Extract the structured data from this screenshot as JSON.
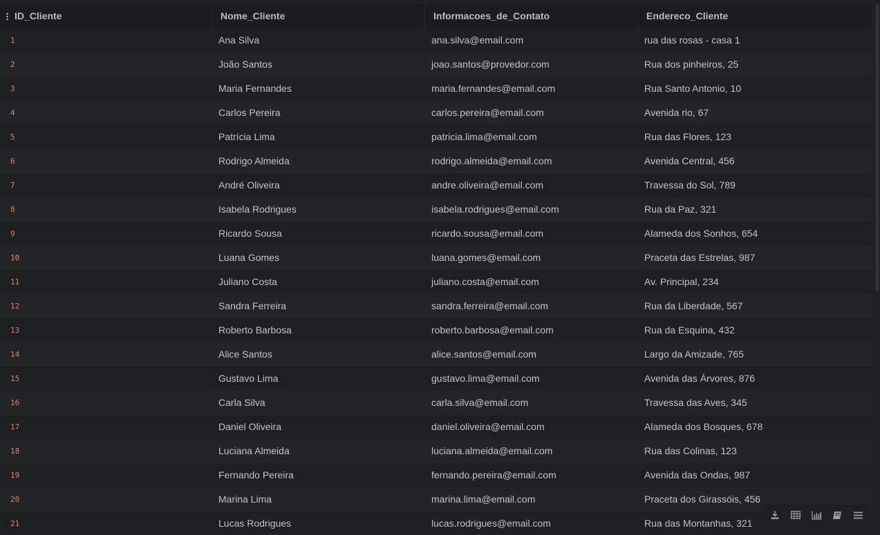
{
  "table": {
    "columns": [
      "ID_Cliente",
      "Nome_Cliente",
      "Informacoes_de_Contato",
      "Endereco_Cliente"
    ],
    "rows": [
      [
        "1",
        "Ana Silva",
        "ana.silva@email.com",
        "rua das rosas - casa 1"
      ],
      [
        "2",
        "João Santos",
        "joao.santos@provedor.com",
        "Rua dos pinheiros, 25"
      ],
      [
        "3",
        "Maria Fernandes",
        "maria.fernandes@email.com",
        "Rua Santo Antonio, 10"
      ],
      [
        "4",
        "Carlos Pereira",
        "carlos.pereira@email.com",
        "Avenida rio, 67"
      ],
      [
        "5",
        "Patrícia Lima",
        "patricia.lima@email.com",
        "Rua das Flores, 123"
      ],
      [
        "6",
        "Rodrigo Almeida",
        "rodrigo.almeida@email.com",
        "Avenida Central, 456"
      ],
      [
        "7",
        "André Oliveira",
        "andre.oliveira@email.com",
        "Travessa do Sol, 789"
      ],
      [
        "8",
        "Isabela Rodrigues",
        "isabela.rodrigues@email.com",
        "Rua da Paz, 321"
      ],
      [
        "9",
        "Ricardo Sousa",
        "ricardo.sousa@email.com",
        "Alameda dos Sonhos, 654"
      ],
      [
        "10",
        "Luana Gomes",
        "luana.gomes@email.com",
        "Praceta das Estrelas, 987"
      ],
      [
        "11",
        "Juliano Costa",
        "juliano.costa@email.com",
        "Av. Principal, 234"
      ],
      [
        "12",
        "Sandra Ferreira",
        "sandra.ferreira@email.com",
        "Rua da Liberdade, 567"
      ],
      [
        "13",
        "Roberto Barbosa",
        "roberto.barbosa@email.com",
        "Rua da Esquina, 432"
      ],
      [
        "14",
        "Alice Santos",
        "alice.santos@email.com",
        "Largo da Amizade, 765"
      ],
      [
        "15",
        "Gustavo Lima",
        "gustavo.lima@email.com",
        "Avenida das Árvores, 876"
      ],
      [
        "16",
        "Carla Silva",
        "carla.silva@email.com",
        "Travessa das Aves, 345"
      ],
      [
        "17",
        "Daniel Oliveira",
        "daniel.oliveira@email.com",
        "Alameda dos Bosques, 678"
      ],
      [
        "18",
        "Luciana Almeida",
        "luciana.almeida@email.com",
        "Rua das Colinas, 123"
      ],
      [
        "19",
        "Fernando Pereira",
        "fernando.pereira@email.com",
        "Avenida das Ondas, 987"
      ],
      [
        "20",
        "Marina Lima",
        "marina.lima@email.com",
        "Praceta dos Girassóis, 456"
      ],
      [
        "21",
        "Lucas Rodrigues",
        "lucas.rodrigues@email.com",
        "Rua das Montanhas, 321"
      ]
    ]
  },
  "toolbar": {
    "buttons": [
      "download-icon",
      "table-icon",
      "bar-chart-icon",
      "book-icon",
      "menu-icon"
    ]
  },
  "colors": {
    "id_accent": "#e8834a",
    "background": "#1e1f23",
    "row_alt": "#232428",
    "header_bg": "#1b1c1f"
  }
}
